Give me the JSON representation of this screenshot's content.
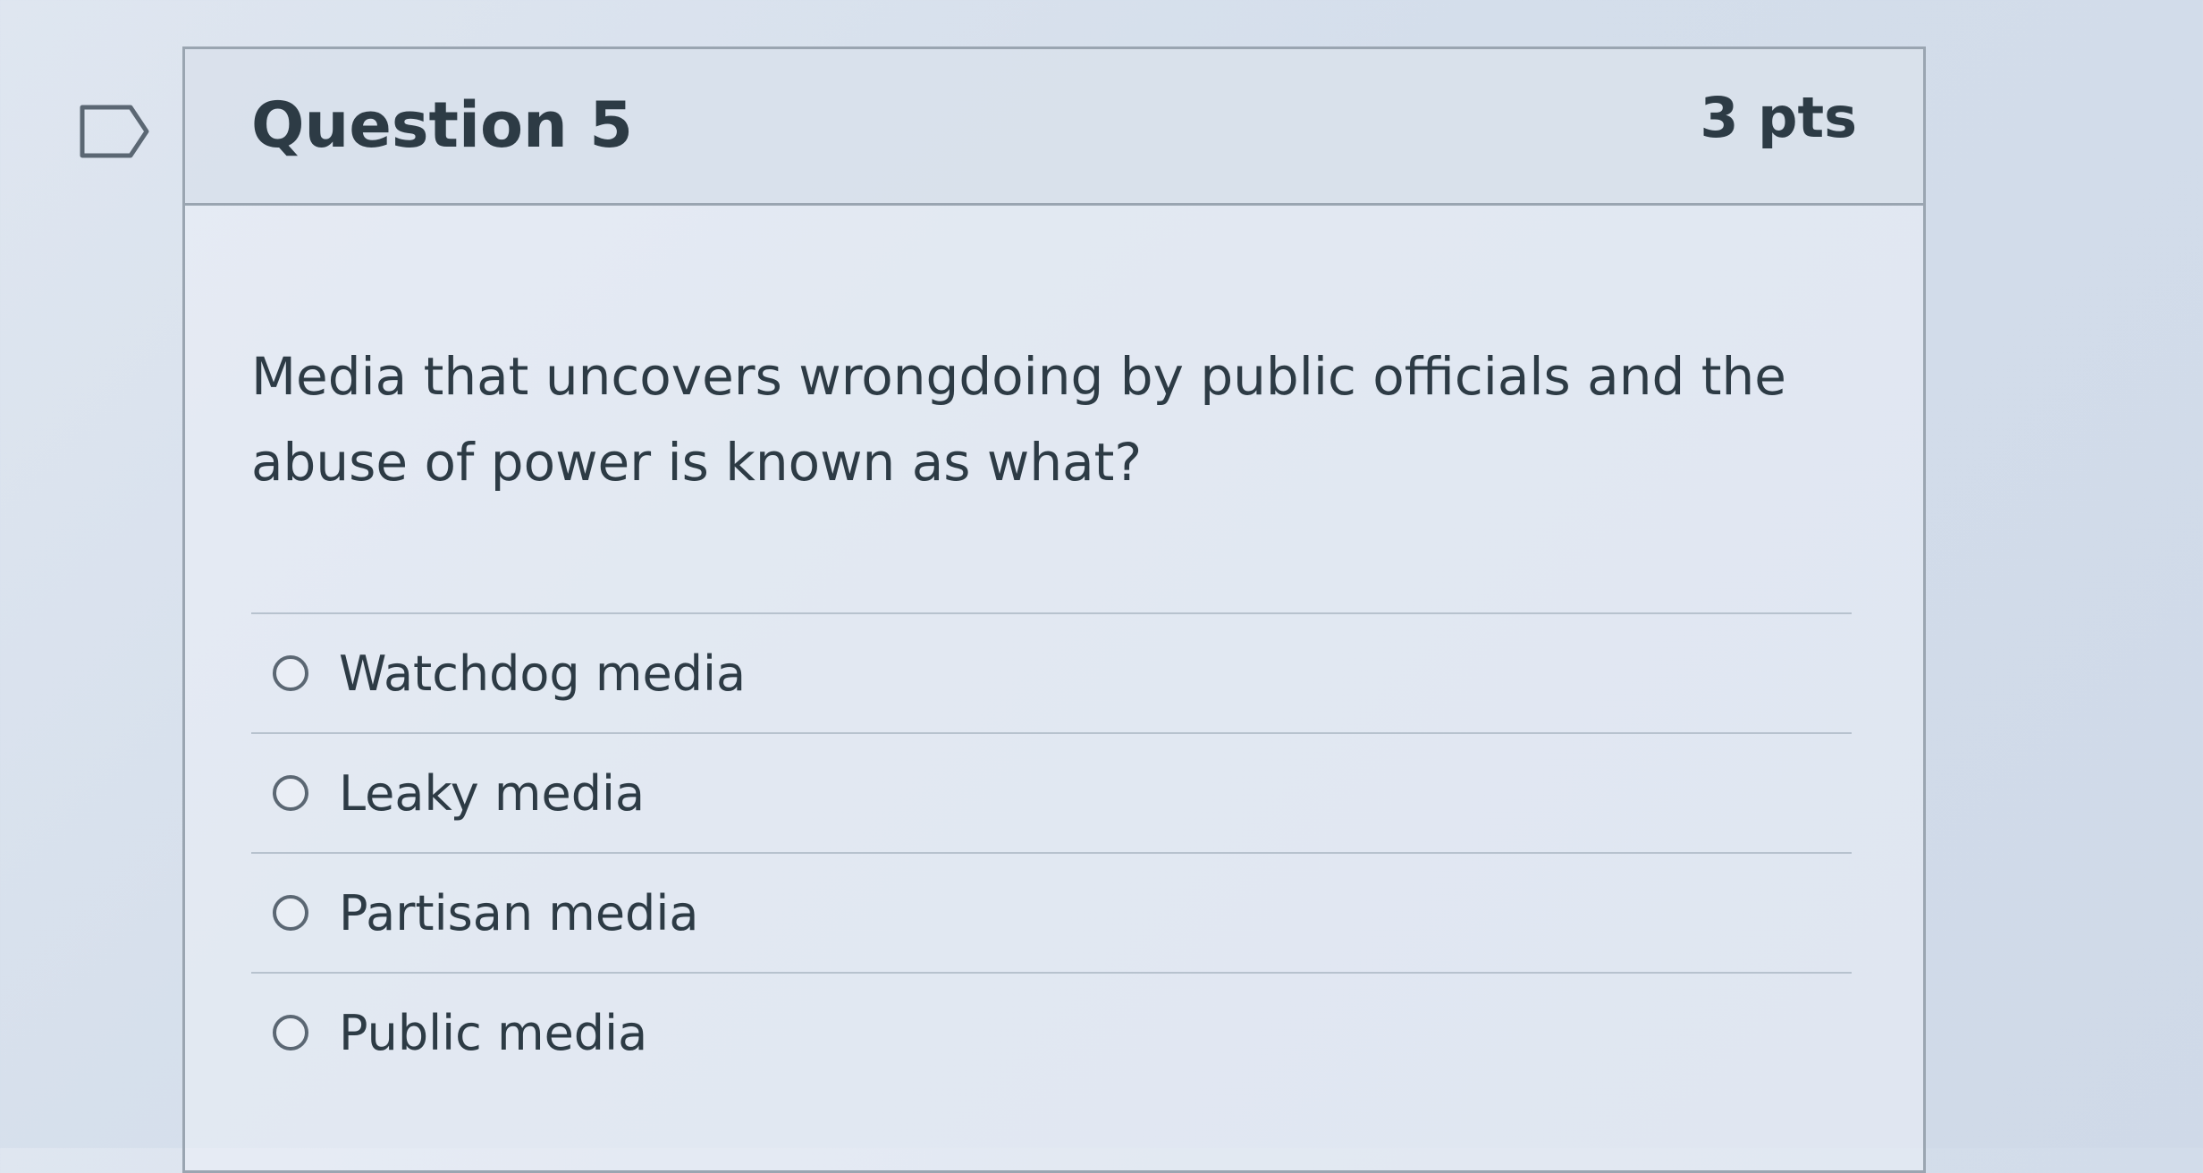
{
  "question": {
    "title": "Question 5",
    "points": "3 pts",
    "text": "Media that uncovers wrongdoing by public officials and the abuse of power is known as what?",
    "flag_icon": "bookmark-flag-icon"
  },
  "answers": [
    {
      "label": "Watchdog media",
      "selected": false
    },
    {
      "label": "Leaky media",
      "selected": false
    },
    {
      "label": "Partisan media",
      "selected": false
    },
    {
      "label": "Public media",
      "selected": false
    }
  ],
  "colors": {
    "text": "#2d3b45",
    "border": "#9aa5b1",
    "header_bg": "#d7dfea"
  }
}
